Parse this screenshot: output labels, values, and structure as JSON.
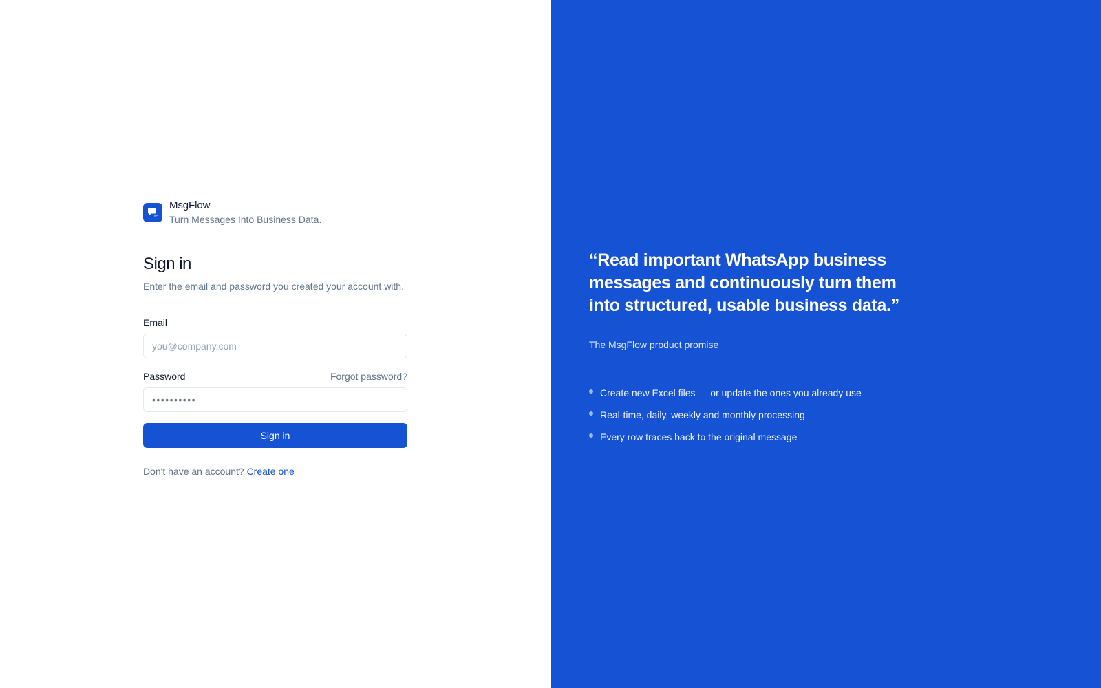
{
  "brand": {
    "name": "MsgFlow",
    "tagline": "Turn Messages Into Business Data."
  },
  "signin": {
    "title": "Sign in",
    "subtitle": "Enter the email and password you created your account with.",
    "email_label": "Email",
    "email_placeholder": "you@company.com",
    "email_value": "",
    "password_label": "Password",
    "forgot_label": "Forgot password?",
    "password_value": "••••••••••",
    "submit_label": "Sign in",
    "signup_prompt": "Don't have an account?",
    "signup_link": "Create one"
  },
  "promo": {
    "quote": "“Read important WhatsApp business messages and continuously turn them into structured, usable business data.”",
    "caption": "The MsgFlow product promise",
    "bullets": [
      "Create new Excel files — or update the ones you already use",
      "Real-time, daily, weekly and monthly processing",
      "Every row traces back to the original message"
    ]
  },
  "colors": {
    "accent": "#1652d4",
    "panel_background": "#1652d4",
    "muted_text": "#64748b",
    "input_border": "#e2e8f0"
  },
  "icons": {
    "logo": "chat-bubble-icon",
    "bullet": "dot-icon"
  }
}
